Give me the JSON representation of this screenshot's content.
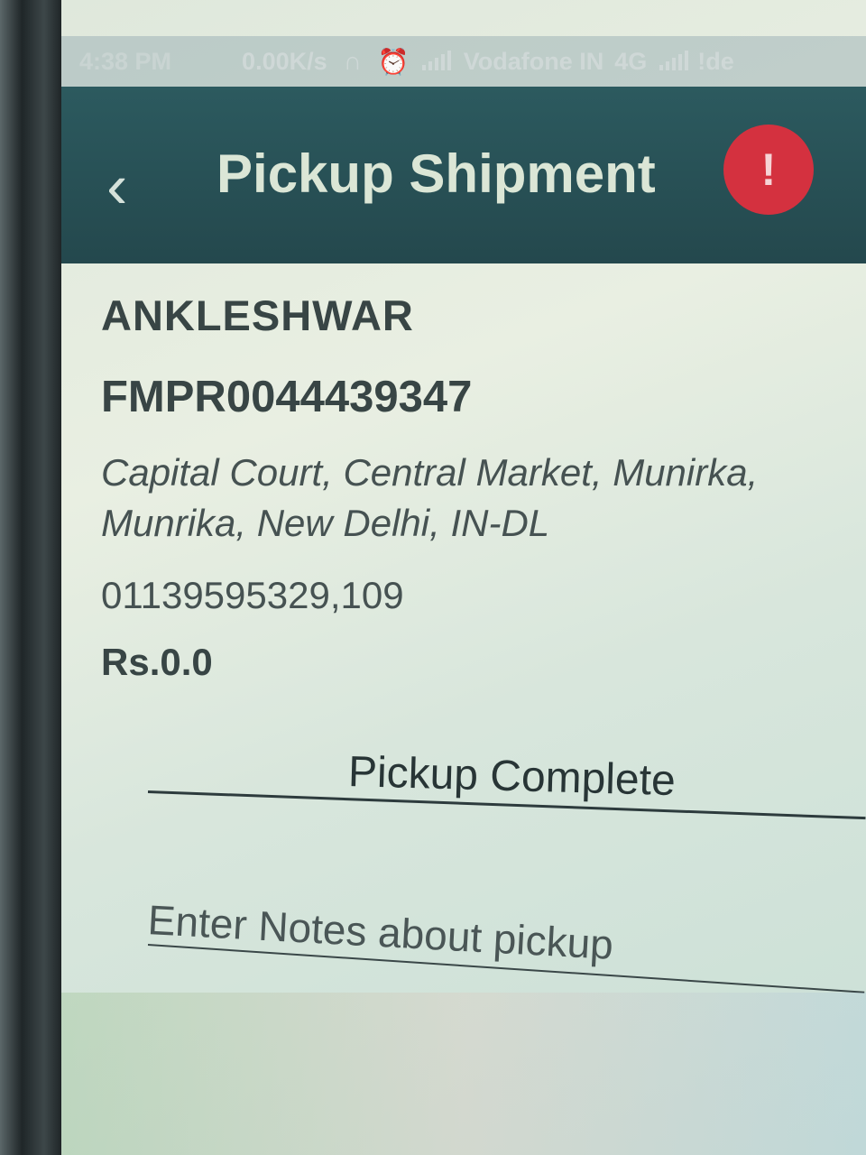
{
  "status_bar": {
    "time": "4:38 PM",
    "speed": "0.00K/s",
    "carrier": "Vodafone IN",
    "network": "4G",
    "carrier_2": "!de"
  },
  "app_bar": {
    "title": "Pickup Shipment",
    "back_icon": "chevron-left-icon",
    "alert_icon": "exclamation-icon",
    "alert_glyph": "!",
    "alert_color": "#d4313f",
    "bar_color": "#24484d"
  },
  "shipment": {
    "company": "ANKLESHWAR",
    "pickup_id": "FMPR0044439347",
    "address_line1": "Capital Court, Central Market, Munirka,",
    "address_line2": "Munrika, New Delhi, IN-DL",
    "phone": "01139595329,109",
    "amount": "Rs.0.0"
  },
  "form": {
    "status_value": "Pickup Complete",
    "notes_placeholder": "Enter Notes about pickup"
  }
}
